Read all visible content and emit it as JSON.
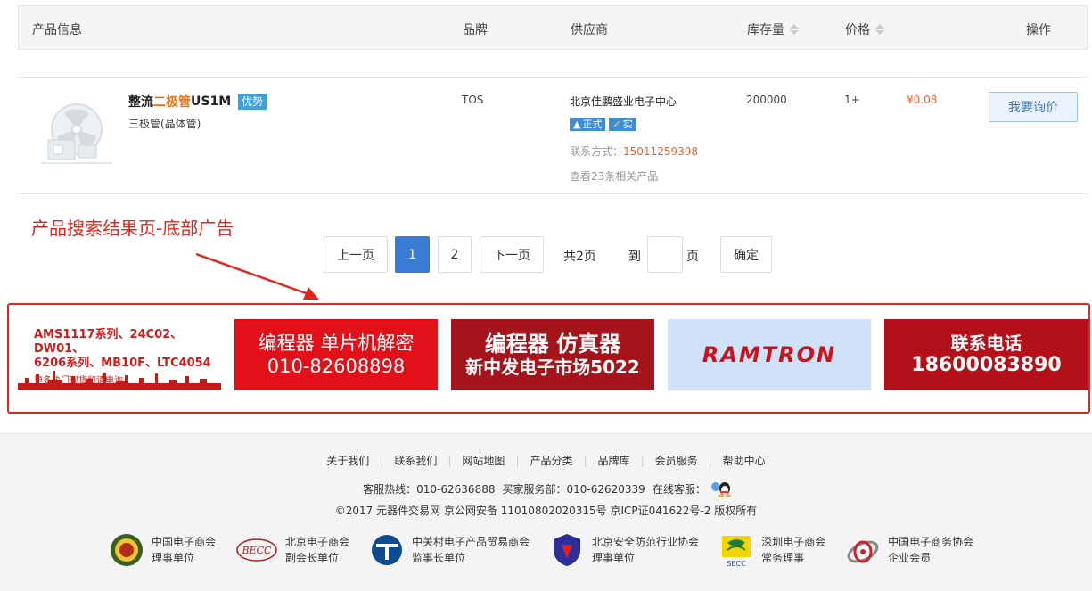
{
  "table_header": {
    "product_info": "产品信息",
    "brand": "品牌",
    "supplier": "供应商",
    "stock": "库存量",
    "price": "价格",
    "action": "操作"
  },
  "product": {
    "name_prefix": "整流",
    "name_highlight": "二极管",
    "name_suffix": "US1M",
    "badge": "优势",
    "category": "三极管(晶体管)",
    "brand": "TOS",
    "supplier": "北京佳鹏盛业电子中心",
    "tag_official": "正式",
    "tag_verified": "实",
    "contact_label": "联系方式：",
    "contact_phone": "15011259398",
    "related_link": "查看23条相关产品",
    "stock": "200000",
    "moq": "1+",
    "price": "¥0.08",
    "inquire_button": "我要询价"
  },
  "annotation": {
    "caption": "产品搜索结果页-底部广告"
  },
  "pagination": {
    "prev": "上一页",
    "pages": [
      "1",
      "2"
    ],
    "current": "1",
    "next": "下一页",
    "total": "共2页",
    "goto_label": "到",
    "page_unit": "页",
    "confirm": "确定",
    "goto_value": ""
  },
  "ads": {
    "ad1": {
      "line1": "AMS1117系列、24C02、DW01、",
      "line2": "6206系列、MB10F、LTC4054",
      "line3": "更多热门现货频请电询"
    },
    "ad2": {
      "line1": "编程器 单片机解密",
      "line2": "010-82608898"
    },
    "ad3": {
      "line1": "编程器 仿真器",
      "line2": "新中发电子市场5022"
    },
    "ad4": {
      "logo": "RAMTRON"
    },
    "ad5": {
      "line1": "联系电话",
      "line2": "18600083890"
    }
  },
  "footer": {
    "links": [
      "关于我们",
      "联系我们",
      "网站地图",
      "产品分类",
      "品牌库",
      "会员服务",
      "帮助中心"
    ],
    "service_hotline": "客服热线：010-62636888",
    "buyer_dept": "买家服务部：010-62620339",
    "online_service": "在线客服：",
    "copyright": "©2017 元器件交易网 京公网安备 11010802020315号 京ICP证041622号-2 版权所有",
    "orgs": [
      {
        "line1": "中国电子商会",
        "line2": "理事单位"
      },
      {
        "line1": "北京电子商会",
        "line2": "副会长单位"
      },
      {
        "line1": "中关村电子产品贸易商会",
        "line2": "监事长单位"
      },
      {
        "line1": "北京安全防范行业协会",
        "line2": "理事单位"
      },
      {
        "line1": "深圳电子商会",
        "line2": "常务理事"
      },
      {
        "line1": "中国电子商务协会",
        "line2": "企业会员"
      }
    ],
    "becc_logo": "BECC",
    "secc_logo": "SECC"
  },
  "colors": {
    "accent_blue": "#3a7bd5",
    "price_orange": "#f0602b",
    "annotation_red": "#e1251b"
  }
}
